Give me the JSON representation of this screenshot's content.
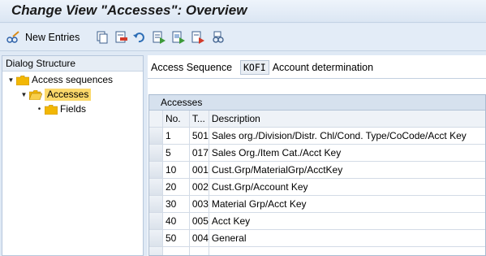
{
  "window": {
    "title": "Change View \"Accesses\": Overview"
  },
  "toolbar": {
    "new_entries_label": "New Entries",
    "icons": [
      "glasses-pencil-icon",
      "copy-icon",
      "delete-icon",
      "undo-icon",
      "select-all-icon",
      "select-block-icon",
      "deselect-all-icon",
      "print-icon"
    ]
  },
  "dialog_structure": {
    "header": "Dialog Structure",
    "items": [
      {
        "label": "Access sequences",
        "level": 0,
        "expanded": true,
        "selected": false
      },
      {
        "label": "Accesses",
        "level": 1,
        "expanded": true,
        "selected": true
      },
      {
        "label": "Fields",
        "level": 2,
        "expanded": false,
        "selected": false
      }
    ]
  },
  "access_sequence": {
    "label": "Access Sequence",
    "value": "KOFI",
    "description": "Account determination"
  },
  "accesses_table": {
    "title": "Accesses",
    "columns": [
      "No.",
      "T...",
      "Description"
    ],
    "rows": [
      {
        "no": "1",
        "t": "501",
        "description": "Sales org./Division/Distr. Chl/Cond. Type/CoCode/Acct Key"
      },
      {
        "no": "5",
        "t": "017",
        "description": "Sales Org./Item Cat./Acct Key"
      },
      {
        "no": "10",
        "t": "001",
        "description": "Cust.Grp/MaterialGrp/AcctKey"
      },
      {
        "no": "20",
        "t": "002",
        "description": "Cust.Grp/Account Key"
      },
      {
        "no": "30",
        "t": "003",
        "description": "Material Grp/Acct Key"
      },
      {
        "no": "40",
        "t": "005",
        "description": "Acct Key"
      },
      {
        "no": "50",
        "t": "004",
        "description": "General"
      }
    ]
  },
  "colors": {
    "background": "#dfe9f5",
    "selection_highlight": "#fbd86a",
    "folder": "#f2b705"
  }
}
